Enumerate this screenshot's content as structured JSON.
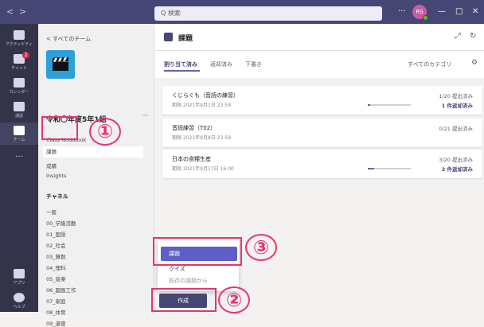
{
  "titlebar": {
    "back": "<",
    "forward": ">",
    "search_placeholder": "Q 検索",
    "more": "···",
    "avatar_initials": "RS",
    "minimize": "—",
    "maximize": "□",
    "close": "✕",
    "bg_color": "#464775"
  },
  "rail": {
    "items": [
      {
        "label": "アクティビティ",
        "icon": "bell-icon"
      },
      {
        "label": "チャット",
        "icon": "chat-icon",
        "badge": "2"
      },
      {
        "label": "カレンダー",
        "icon": "calendar-icon"
      },
      {
        "label": "通話",
        "icon": "phone-icon"
      },
      {
        "label": "チーム",
        "icon": "teams-icon"
      },
      {
        "label": "···",
        "icon": "more-icon"
      },
      {
        "label": "アプリ",
        "icon": "apps-icon"
      },
      {
        "label": "ヘルプ",
        "icon": "help-icon"
      }
    ]
  },
  "teampane": {
    "back_label": "< すべてのチーム",
    "team_name": "令和〇年度5年1組",
    "more": "···",
    "nav_items": [
      "Class Notebook",
      "課題",
      "成績",
      "Insights"
    ],
    "channels_header": "チャネル",
    "channels": [
      "一般",
      "00_学級活動",
      "01_国語",
      "02_社会",
      "03_算数",
      "04_理科",
      "05_音楽",
      "06_図画工作",
      "07_家庭",
      "08_体育",
      "09_道徳"
    ]
  },
  "main": {
    "title": "課題",
    "expand_icon": "⤢",
    "refresh_icon": "↻",
    "tabs": [
      "割り当て済み",
      "返却済み",
      "下書き"
    ],
    "category": "すべてのカテゴリ",
    "assignments": [
      {
        "title": "くじらぐも（音読の練習）",
        "due": "期限 2021年9月1日 23:59",
        "submitted": "1/20 提出済み",
        "returned": "1 件返却済み",
        "progress": 0.05
      },
      {
        "title": "音読練習（T02）",
        "due": "期限 2021年9月8日 23:59",
        "submitted": "0/21 提出済み",
        "returned": "",
        "progress": 0.0
      },
      {
        "title": "日本の食糧生産",
        "due": "期限 2021年9月17日 16:00",
        "submitted": "3/20 提出済み",
        "returned": "2 件返却済み",
        "progress": 0.15
      }
    ],
    "popup_items": [
      "課題",
      "クイズ",
      "既存の課題から"
    ],
    "create_label": "作成"
  },
  "annotations": {
    "marker1": "①",
    "marker2": "②",
    "marker3": "③",
    "color": "#e8336e"
  }
}
